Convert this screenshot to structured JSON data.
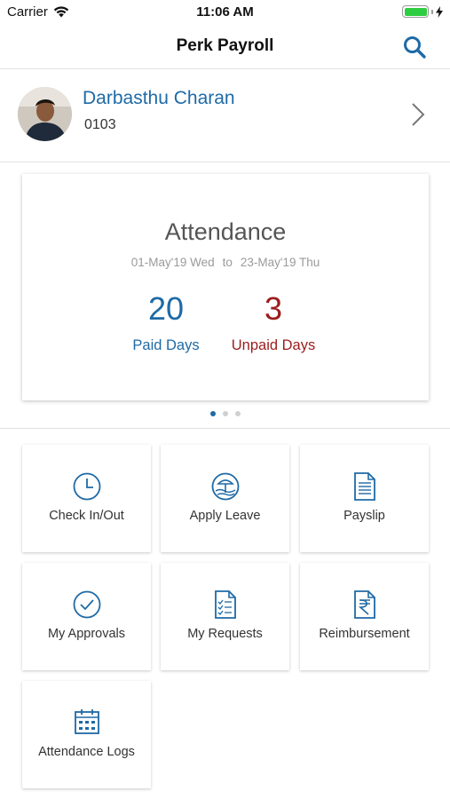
{
  "status_bar": {
    "carrier": "Carrier",
    "time": "11:06 AM"
  },
  "nav": {
    "title": "Perk Payroll"
  },
  "profile": {
    "name": "Darbasthu Charan",
    "id": "0103"
  },
  "attendance": {
    "title": "Attendance",
    "from": "01-May'19 Wed",
    "to_word": "to",
    "to": "23-May'19 Thu",
    "paid_value": "20",
    "paid_label": "Paid Days",
    "unpaid_value": "3",
    "unpaid_label": "Unpaid Days",
    "page_dots": 3,
    "active_dot": 1
  },
  "tiles": [
    {
      "label": "Check In/Out",
      "icon": "clock-icon"
    },
    {
      "label": "Apply Leave",
      "icon": "beach-icon"
    },
    {
      "label": "Payslip",
      "icon": "document-icon"
    },
    {
      "label": "My Approvals",
      "icon": "checkmark-circle-icon"
    },
    {
      "label": "My Requests",
      "icon": "checklist-icon"
    },
    {
      "label": "Reimbursement",
      "icon": "rupee-document-icon"
    },
    {
      "label": "Attendance Logs",
      "icon": "calendar-icon"
    }
  ],
  "colors": {
    "accent": "#1e6aa6",
    "unpaid": "#9b1c1c",
    "battery": "#2ecc40"
  }
}
